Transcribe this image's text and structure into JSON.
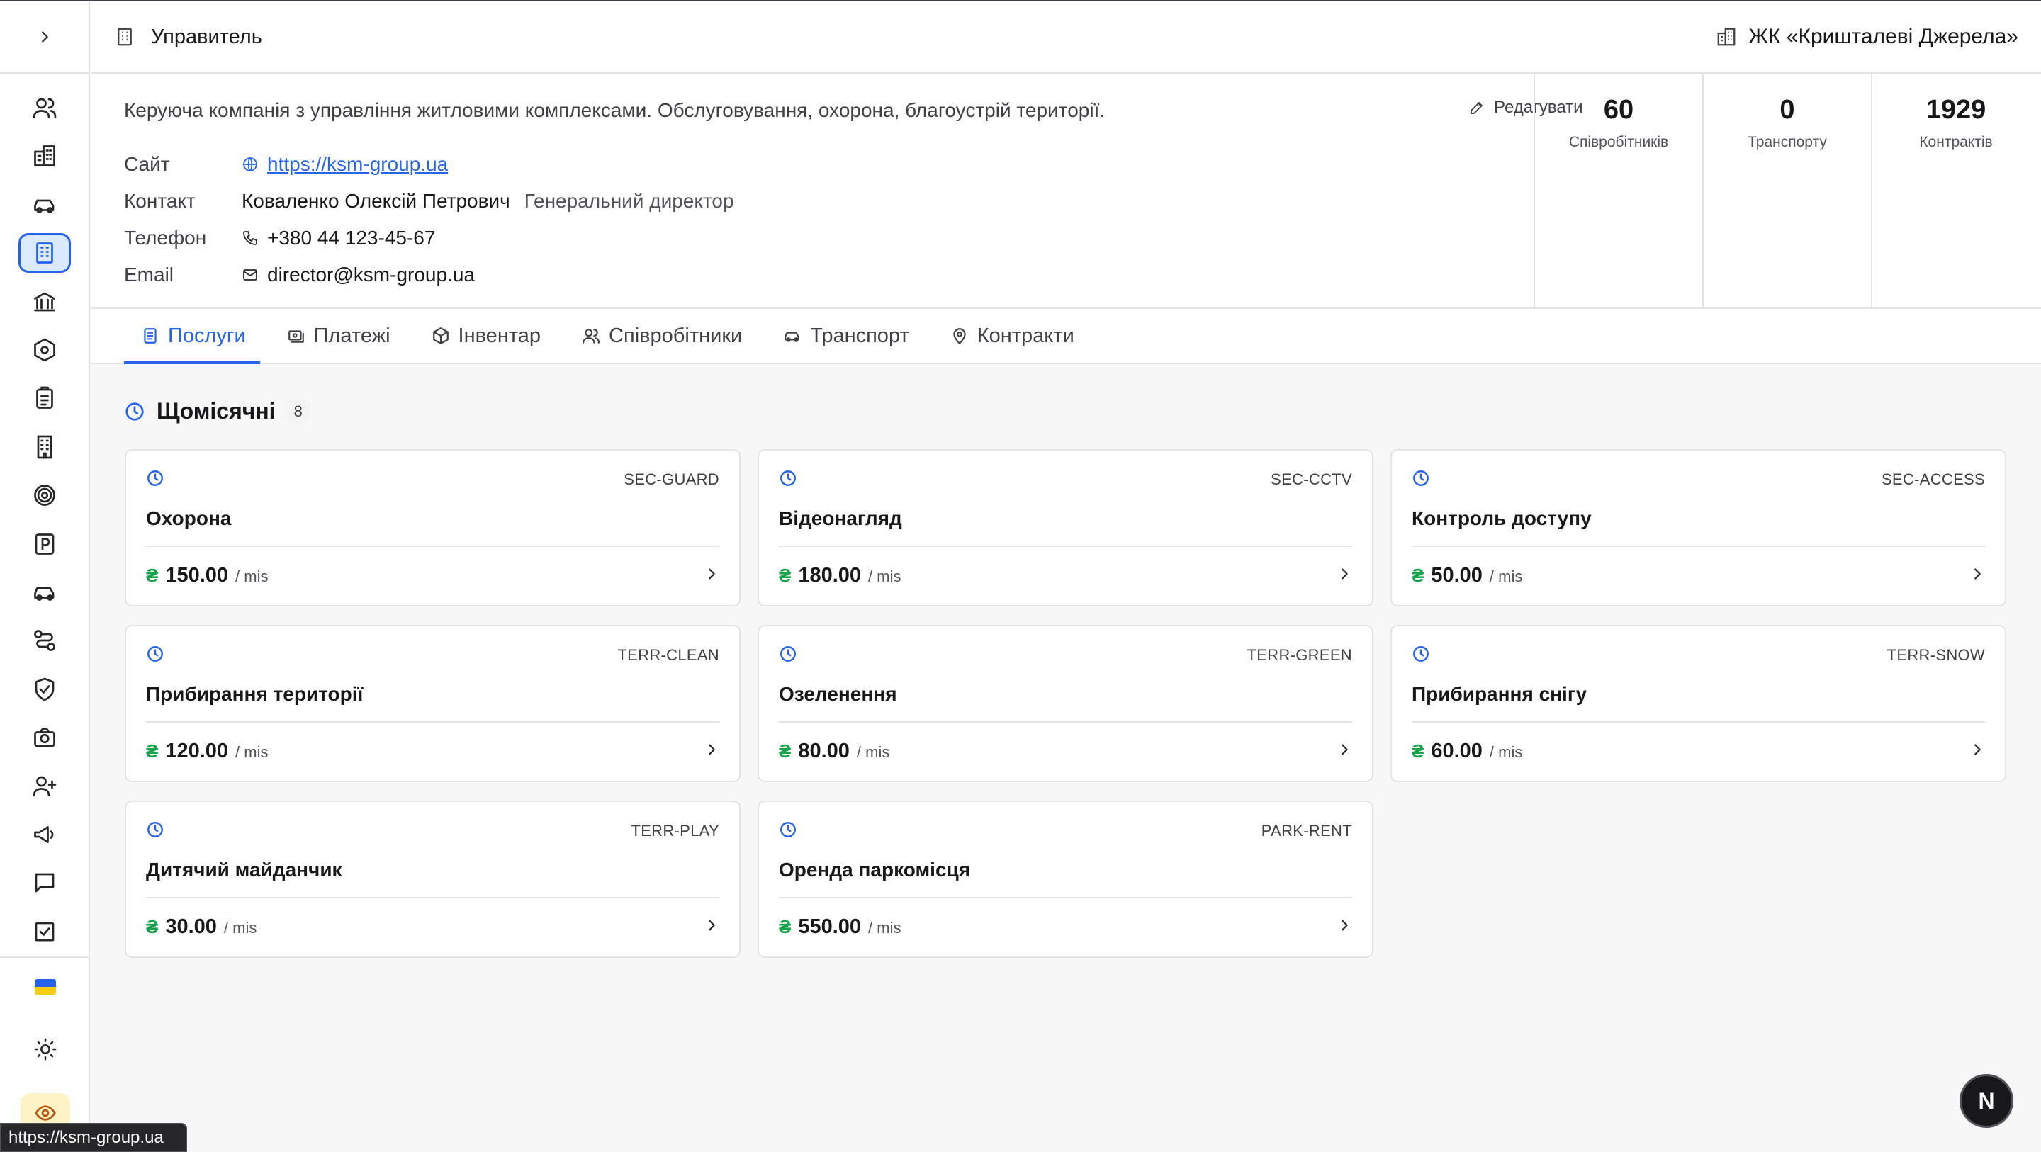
{
  "header": {
    "title": "Управитель",
    "complex": "ЖК «Кришталеві Джерела»"
  },
  "company": {
    "description": "Керуюча компанія з управління житловими комплексами. Обслуговування, охорона, благоустрій території.",
    "edit_label": "Редагувати",
    "site_label": "Сайт",
    "site_url": "https://ksm-group.ua",
    "contact_label": "Контакт",
    "contact_name": "Коваленко Олексій Петрович",
    "contact_role": "Генеральний директор",
    "phone_label": "Телефон",
    "phone": "+380 44 123-45-67",
    "email_label": "Email",
    "email": "director@ksm-group.ua"
  },
  "stats": [
    {
      "value": "60",
      "label": "Співробітників"
    },
    {
      "value": "0",
      "label": "Транспорту"
    },
    {
      "value": "1929",
      "label": "Контрактів"
    }
  ],
  "tabs": [
    {
      "label": "Послуги",
      "icon": "document-icon",
      "active": true
    },
    {
      "label": "Платежі",
      "icon": "payments-icon"
    },
    {
      "label": "Інвентар",
      "icon": "box-icon"
    },
    {
      "label": "Співробітники",
      "icon": "users-icon"
    },
    {
      "label": "Транспорт",
      "icon": "car-icon"
    },
    {
      "label": "Контракти",
      "icon": "map-pin-icon"
    }
  ],
  "section": {
    "title": "Щомісячні",
    "count": "8"
  },
  "currency_symbol": "₴",
  "per_label": "/ mis",
  "services": [
    {
      "code": "SEC-GUARD",
      "name": "Охорона",
      "price": "150.00"
    },
    {
      "code": "SEC-CCTV",
      "name": "Відеонагляд",
      "price": "180.00"
    },
    {
      "code": "SEC-ACCESS",
      "name": "Контроль доступу",
      "price": "50.00"
    },
    {
      "code": "TERR-CLEAN",
      "name": "Прибирання території",
      "price": "120.00"
    },
    {
      "code": "TERR-GREEN",
      "name": "Озеленення",
      "price": "80.00"
    },
    {
      "code": "TERR-SNOW",
      "name": "Прибирання снігу",
      "price": "60.00"
    },
    {
      "code": "TERR-PLAY",
      "name": "Дитячий майданчик",
      "price": "30.00"
    },
    {
      "code": "PARK-RENT",
      "name": "Оренда паркомісця",
      "price": "550.00"
    }
  ],
  "sidebar_icons": [
    "users-icon",
    "buildings-icon",
    "car-icon",
    "building-icon",
    "bank-icon",
    "hexagon-icon",
    "clipboard-icon",
    "office-icon",
    "target-icon",
    "parking-icon",
    "car-icon",
    "route-icon",
    "shield-check-icon",
    "camera-icon",
    "user-plus-icon",
    "megaphone-icon",
    "chat-icon",
    "ballot-icon"
  ],
  "status_tooltip": "https://ksm-group.ua",
  "floating_button": "N",
  "colors": {
    "accent": "#2563eb",
    "currency": "#16a34a"
  }
}
